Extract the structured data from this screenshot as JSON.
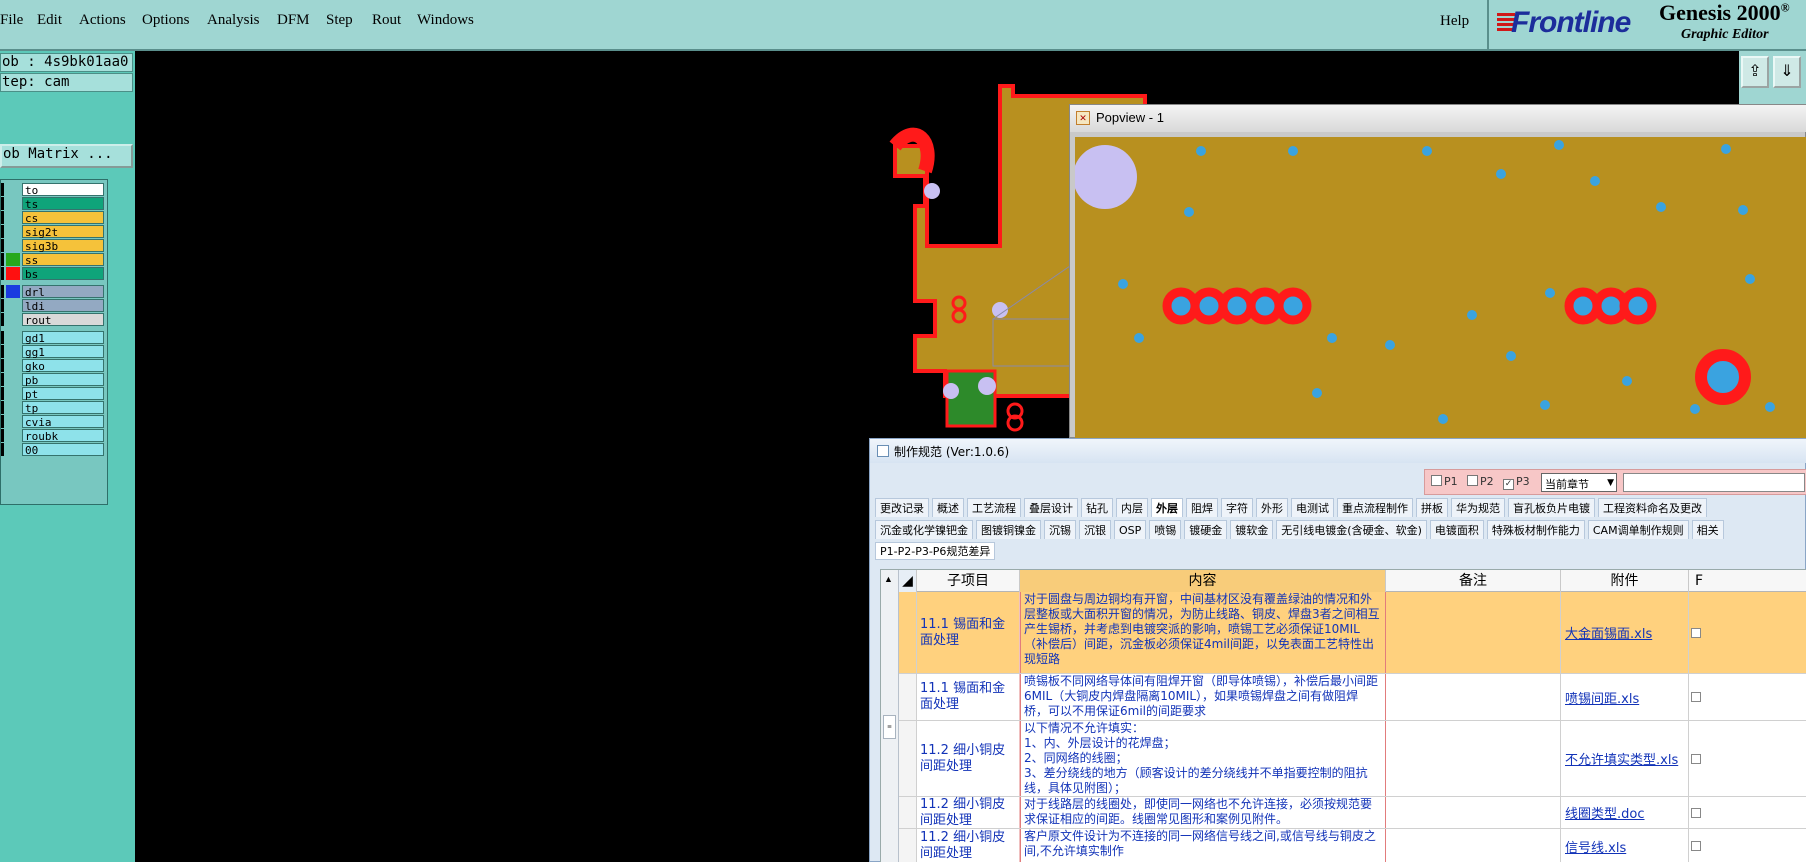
{
  "app": {
    "brand_logo": "Frontline",
    "brand_name": "Genesis 2000",
    "brand_superscript": "®",
    "brand_subtitle": "Graphic Editor",
    "colors": {
      "toolbar": "#9fd6d2",
      "panel": "#5cc9b9",
      "board_fill": "#b8901f",
      "board_outline": "#ff1a1a"
    }
  },
  "menu": {
    "items": [
      "File",
      "Edit",
      "Actions",
      "Options",
      "Analysis",
      "DFM",
      "Step",
      "Rout",
      "Windows"
    ],
    "help": "Help"
  },
  "left_panel": {
    "job": "ob : 4s9bk01aa0",
    "step": "tep: cam",
    "job_matrix": "ob Matrix ..."
  },
  "layers": [
    {
      "name": "to",
      "color": "#ffffff"
    },
    {
      "name": "ts",
      "color": "#0fa47a"
    },
    {
      "name": "cs",
      "color": "#f5c23a"
    },
    {
      "name": "sig2t",
      "color": "#f5c23a"
    },
    {
      "name": "sig3b",
      "color": "#f5c23a"
    },
    {
      "name": "ss",
      "color": "#f5c23a",
      "swatch": "#27a81d"
    },
    {
      "name": "bs",
      "color": "#0fa47a",
      "swatch": "#ff1010"
    },
    {
      "name": "drl",
      "color": "#93a9c2",
      "swatch": "#1a3ae0"
    },
    {
      "name": "ldi",
      "color": "#93a9c2"
    },
    {
      "name": "rout",
      "color": "#d9d9d9"
    },
    {
      "name": "gd1",
      "color": "#8ee2ea"
    },
    {
      "name": "gg1",
      "color": "#8ee2ea"
    },
    {
      "name": "gko",
      "color": "#8ee2ea"
    },
    {
      "name": "pb",
      "color": "#8ee2ea"
    },
    {
      "name": "pt",
      "color": "#8ee2ea"
    },
    {
      "name": "tp",
      "color": "#8ee2ea"
    },
    {
      "name": "cvia",
      "color": "#8ee2ea"
    },
    {
      "name": "roubk",
      "color": "#8ee2ea"
    },
    {
      "name": "00",
      "color": "#8ee2ea"
    }
  ],
  "popview": {
    "title": "Popview - 1"
  },
  "spec_window": {
    "title": "制作规范 (Ver:1.0.6)",
    "filters": [
      "P1",
      "P2",
      "P3"
    ],
    "filter_checked": [
      false,
      false,
      true
    ],
    "chapter_select": "当前章节",
    "tabs_row1": [
      "更改记录",
      "概述",
      "工艺流程",
      "叠层设计",
      "钻孔",
      "内层",
      "外层",
      "阻焊",
      "字符",
      "外形",
      "电测试",
      "重点流程制作",
      "拼板",
      "华为规范",
      "盲孔板负片电镀",
      "工程资料命名及更改"
    ],
    "active_tab": 6,
    "tabs_row2": [
      "沉金或化学镍钯金",
      "图镀铜镍金",
      "沉锡",
      "沉银",
      "OSP",
      "喷锡",
      "镀硬金",
      "镀软金",
      "无引线电镀金(含硬金、软金)",
      "电镀面积",
      "特殊板材制作能力",
      "CAM调单制作规则",
      "相关"
    ],
    "subtab": "P1-P2-P3-P6规范差异",
    "columns": {
      "sub": "子项目",
      "content": "内容",
      "note": "备注",
      "attachment": "附件",
      "more": "F"
    },
    "rows": [
      {
        "sub": "11.1 锡面和金面处理",
        "content": "对于圆盘与周边铜均有开窗，中间基材区没有覆盖绿油的情况和外层整板或大面积开窗的情况，为防止线路、铜皮、焊盘3者之间相互产生锡桥，并考虑到电镀突派的影响，喷锡工艺必须保证10MIL（补偿后）间距，沉金板必须保证4mil间距，以免表面工艺特性出现短路",
        "note": "",
        "attachment": "大金面锡面.xls",
        "selected": true
      },
      {
        "sub": "11.1 锡面和金面处理",
        "content": "喷锡板不同网络导体间有阻焊开窗（即导体喷锡），补偿后最小间距6MIL（大铜皮内焊盘隔离10MIL），如果喷锡焊盘之间有做阻焊桥，可以不用保证6mil的间距要求",
        "note": "",
        "attachment": "喷锡间距.xls",
        "selected": false
      },
      {
        "sub": "11.2 细小铜皮间距处理",
        "content": "以下情况不允许填实：\n1、内、外层设计的花焊盘；\n2、同网络的线圈；\n3、差分绕线的地方（顾客设计的差分绕线并不单指要控制的阻抗线，具体见附图）；",
        "note": "",
        "attachment": "不允许填实类型.xls",
        "selected": false
      },
      {
        "sub": "11.2 细小铜皮间距处理",
        "content": "对于线路层的线圈处，即使同一网络也不允许连接，必须按规范要求保证相应的间距。线圈常见图形和案例见附件。",
        "note": "",
        "attachment": "线圈类型.doc",
        "selected": false
      },
      {
        "sub": "11.2 细小铜皮间距处理",
        "content": "客户原文件设计为不连接的同一网络信号线之间,或信号线与铜皮之间,不允许填实制作",
        "note": "",
        "attachment": "信号线.xls",
        "selected": false
      }
    ]
  }
}
